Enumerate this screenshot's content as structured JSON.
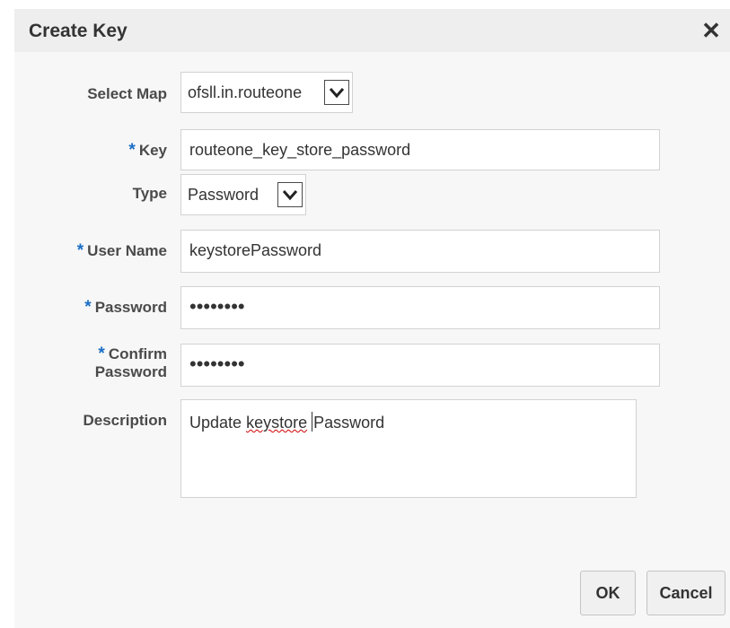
{
  "dialog": {
    "title": "Create Key",
    "close_label": "✕"
  },
  "form": {
    "required_marker": "*",
    "select_map": {
      "label": "Select Map",
      "value": "ofsll.in.routeone"
    },
    "key": {
      "label": "Key",
      "value": "routeone_key_store_password"
    },
    "type": {
      "label": "Type",
      "value": "Password"
    },
    "user_name": {
      "label": "User Name",
      "value": "keystorePassword"
    },
    "password": {
      "label": "Password",
      "value": "••••••••"
    },
    "confirm_password": {
      "label_line1": "Confirm",
      "label_line2": "Password",
      "value": "••••••••"
    },
    "description": {
      "label": "Description",
      "word1": "Update",
      "word2": "keystore",
      "word3": "Password"
    }
  },
  "buttons": {
    "ok_label": "OK",
    "cancel_label": "Cancel"
  }
}
